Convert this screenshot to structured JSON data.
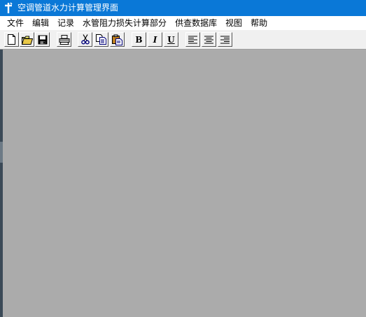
{
  "window": {
    "title": "空调管道水力计算管理界面",
    "icon": "app-icon"
  },
  "menu": {
    "items": [
      {
        "label": "文件"
      },
      {
        "label": "编辑"
      },
      {
        "label": "记录"
      },
      {
        "label": "水管阻力损失计算部分"
      },
      {
        "label": "供查数据库"
      },
      {
        "label": "视图"
      },
      {
        "label": "帮助"
      }
    ]
  },
  "toolbar": {
    "buttons": [
      {
        "icon": "new-document-icon"
      },
      {
        "icon": "open-folder-icon"
      },
      {
        "icon": "save-icon"
      },
      {
        "icon": "print-icon"
      },
      {
        "icon": "cut-icon"
      },
      {
        "icon": "copy-icon"
      },
      {
        "icon": "paste-icon"
      },
      {
        "icon": "bold-icon",
        "label": "B"
      },
      {
        "icon": "italic-icon",
        "label": "I"
      },
      {
        "icon": "underline-icon",
        "label": "U"
      },
      {
        "icon": "align-left-icon"
      },
      {
        "icon": "align-center-icon"
      },
      {
        "icon": "align-right-icon"
      }
    ]
  },
  "colors": {
    "titlebar": "#0a78d7",
    "workspace": "#ababab",
    "toolbar": "#f0f0f0"
  }
}
